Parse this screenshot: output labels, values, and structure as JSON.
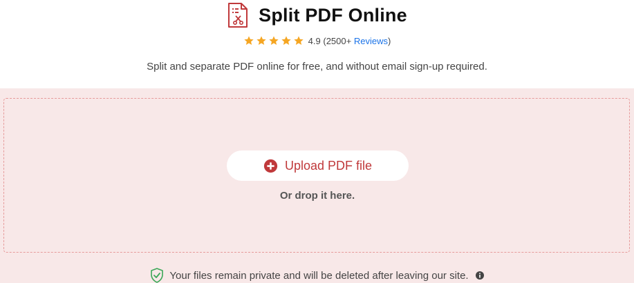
{
  "header": {
    "title": "Split PDF Online",
    "title_icon": "pdf-scissors-icon",
    "rating": {
      "stars": 5,
      "score": "4.9",
      "count_text": "(2500+",
      "reviews_link": "Reviews",
      "closing": ")"
    },
    "subtitle": "Split and separate PDF online for free, and without email sign-up required."
  },
  "upload": {
    "button_label": "Upload PDF file",
    "drop_hint": "Or drop it here."
  },
  "privacy": {
    "text": "Your files remain private and will be deleted after leaving our site."
  },
  "colors": {
    "accent": "#c0393b",
    "star": "#f5a623",
    "link": "#1a73e8",
    "dropzone_bg": "#f8e8e8",
    "dropzone_border": "#e69a9a",
    "shield": "#3aa757"
  }
}
